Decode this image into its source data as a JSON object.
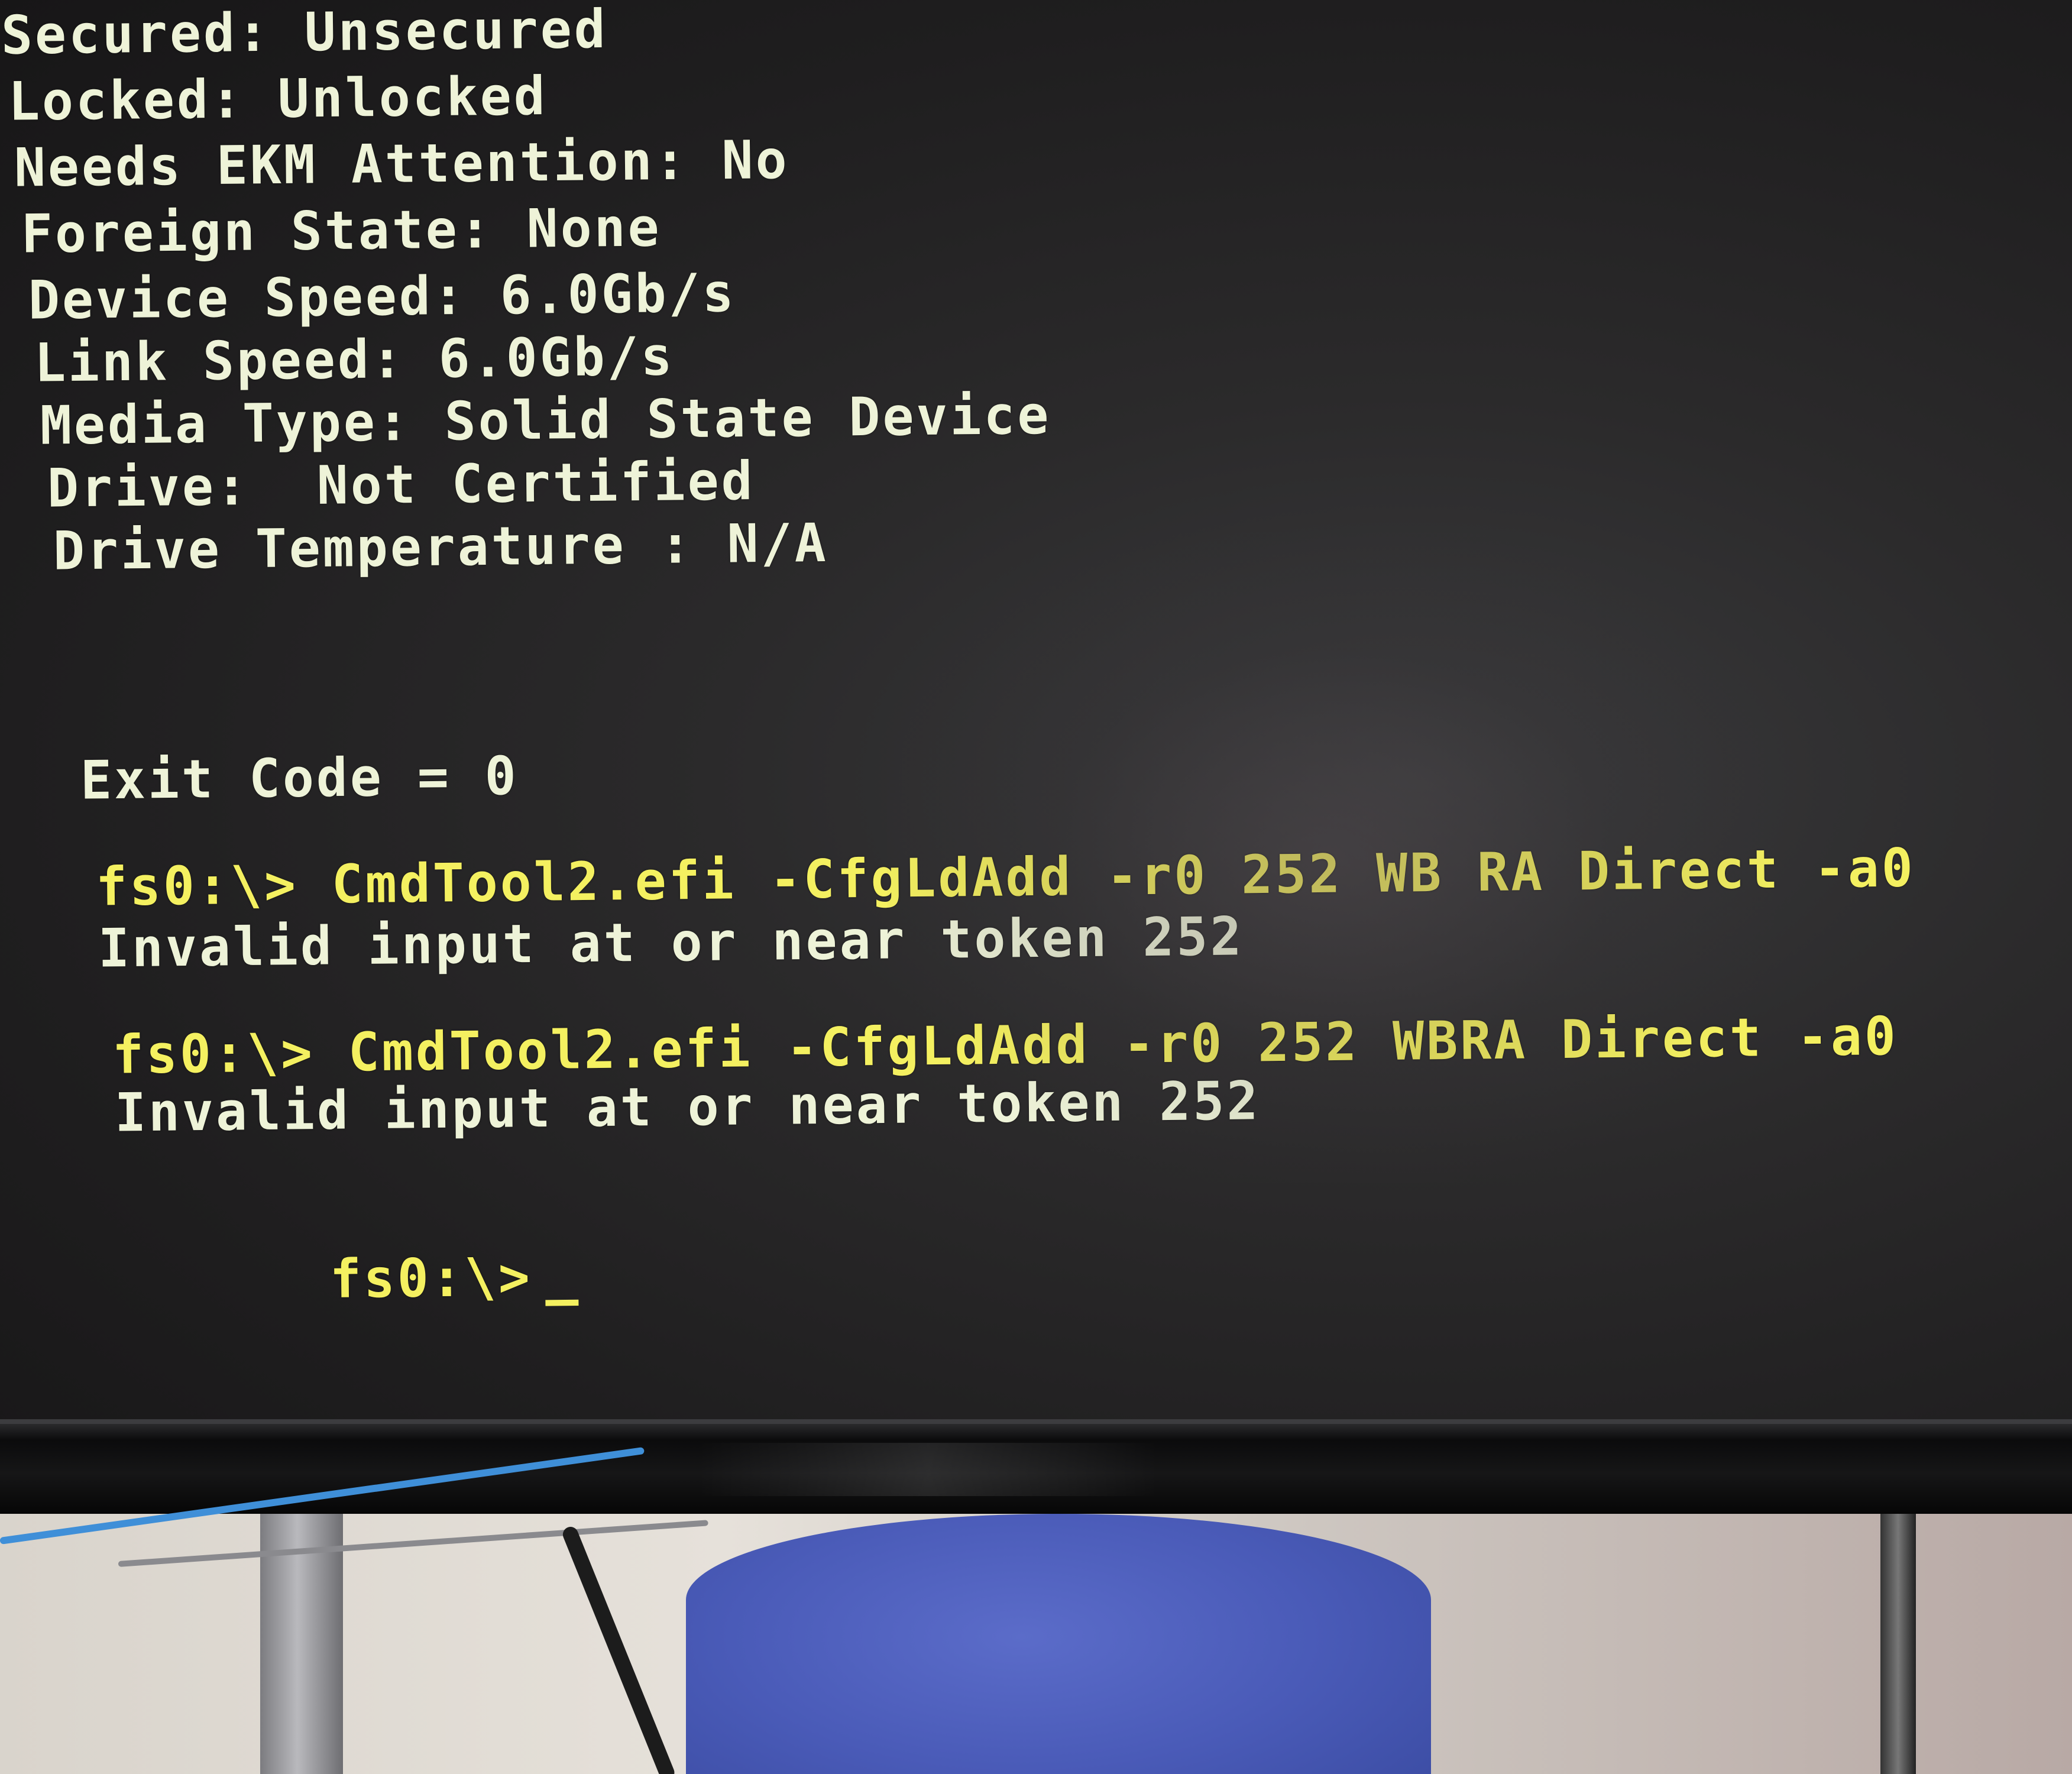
{
  "terminal": {
    "lines": [
      "Secured: Unsecured",
      "Locked: Unlocked",
      "Needs EKM Attention: No",
      "Foreign State: None",
      "Device Speed: 6.0Gb/s",
      "Link Speed: 6.0Gb/s",
      "Media Type: Solid State Device",
      "Drive:  Not Certified",
      "Drive Temperature : N/A"
    ],
    "exit_code": "Exit Code = 0",
    "command_1": "fs0:\\> CmdTool2.efi -CfgLdAdd -r0 252 WB RA Direct -a0",
    "error_1": "Invalid input at or near token 252",
    "command_2": "fs0:\\> CmdTool2.efi -CfgLdAdd -r0 252 WBRA Direct -a0",
    "error_2": "Invalid input at or near token 252",
    "prompt": "fs0:\\>"
  },
  "colors": {
    "output_text": "#eef3d8",
    "command_text": "#f4f060",
    "screen_background": "#222122"
  }
}
